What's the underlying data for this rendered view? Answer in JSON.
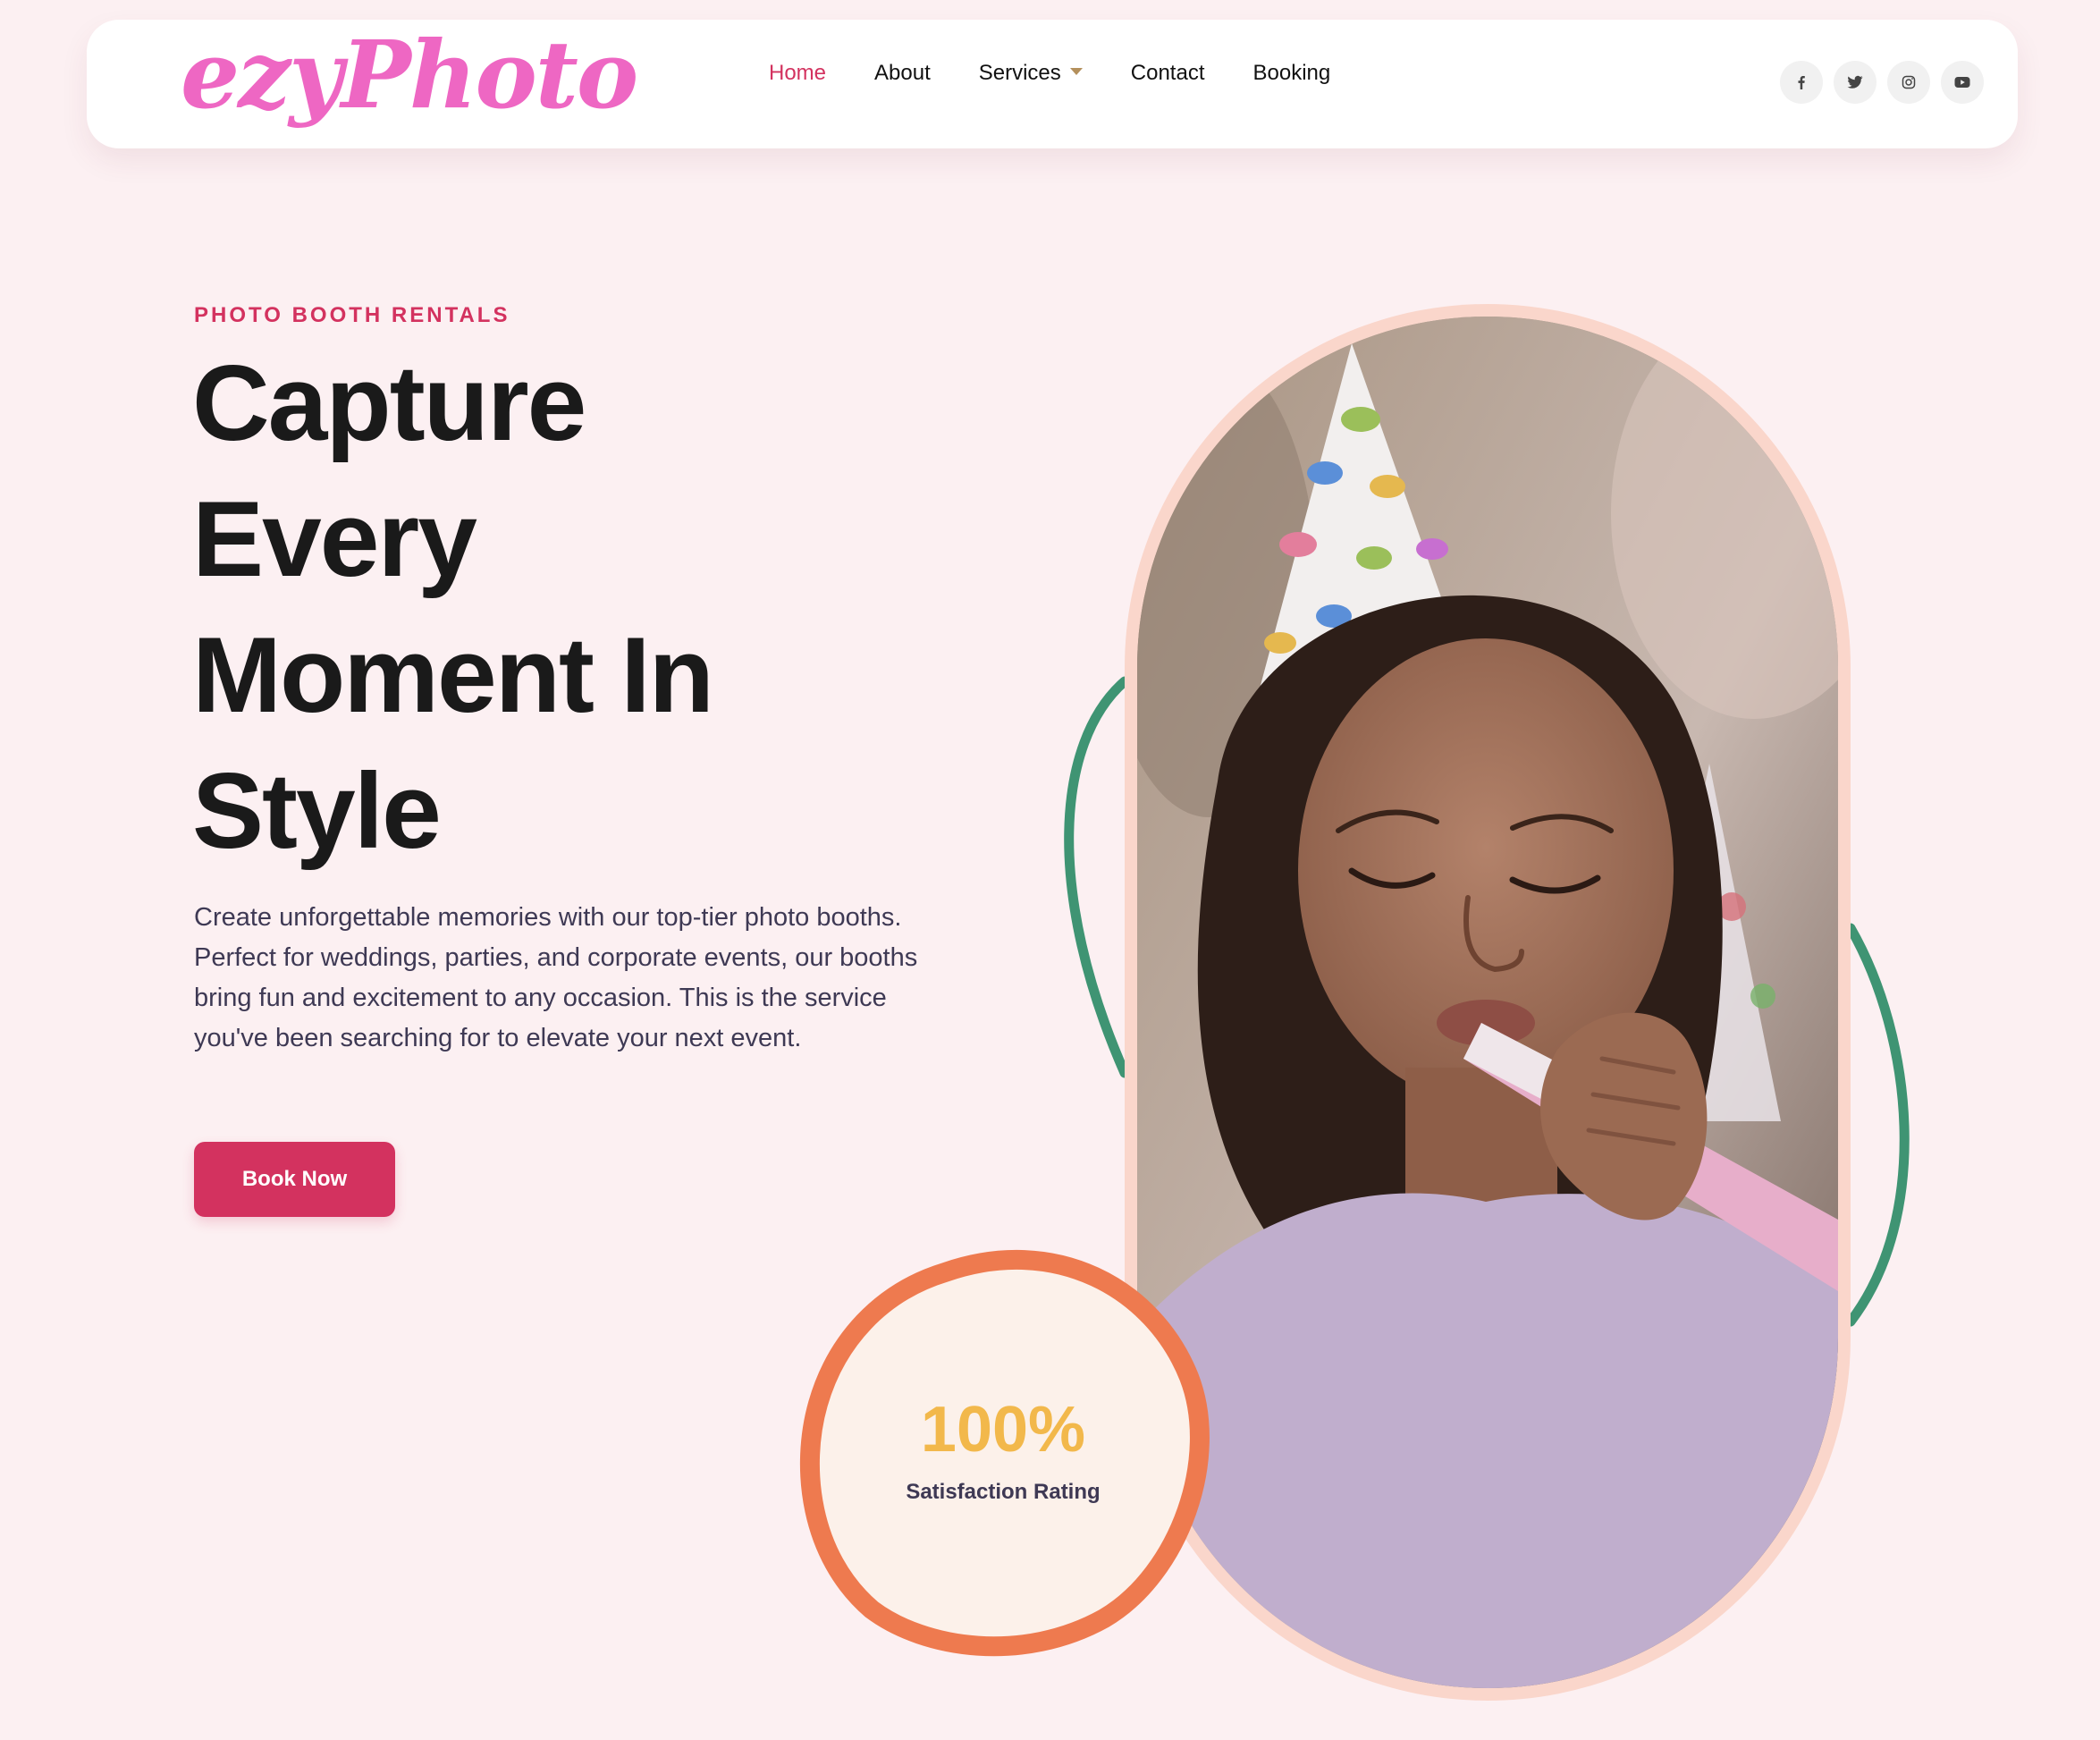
{
  "brand": {
    "logo_text": "ezyPhoto",
    "logo_icon": "script-wordmark-logo"
  },
  "nav": {
    "items": [
      {
        "label": "Home",
        "active": true
      },
      {
        "label": "About",
        "active": false
      },
      {
        "label": "Services",
        "active": false,
        "has_dropdown": true,
        "icon": "caret-down-icon"
      },
      {
        "label": "Contact",
        "active": false
      },
      {
        "label": "Booking",
        "active": false
      }
    ]
  },
  "socials": [
    {
      "icon": "facebook-icon",
      "label": "f"
    },
    {
      "icon": "twitter-icon"
    },
    {
      "icon": "instagram-icon"
    },
    {
      "icon": "youtube-icon"
    }
  ],
  "hero": {
    "eyebrow": "PHOTO BOOTH RENTALS",
    "headline_lines": [
      "Capture",
      "Every",
      "Moment In",
      "Style"
    ],
    "description": "Create unforgettable memories with our top-tier photo booths. Perfect for weddings, parties, and corporate events, our booths bring fun and excitement to any occasion. This is the service you've been searching for to elevate your next event.",
    "cta_label": "Book Now",
    "image_icon": "child-with-party-horn-photo"
  },
  "rating": {
    "value": "100%",
    "label": "Satisfaction Rating"
  },
  "colors": {
    "page_bg": "#fcf0f2",
    "accent": "#d3325f",
    "logo": "#ee67c3",
    "heading": "#1a1a1a",
    "body_text": "#3e3954",
    "green_outline": "#3f9473",
    "orange_outline": "#ee7a4f",
    "peach_frame": "#fad6cb",
    "badge_fill": "#fcf1ea",
    "rating_number": "#f2b84b",
    "caret": "#b4905c"
  }
}
